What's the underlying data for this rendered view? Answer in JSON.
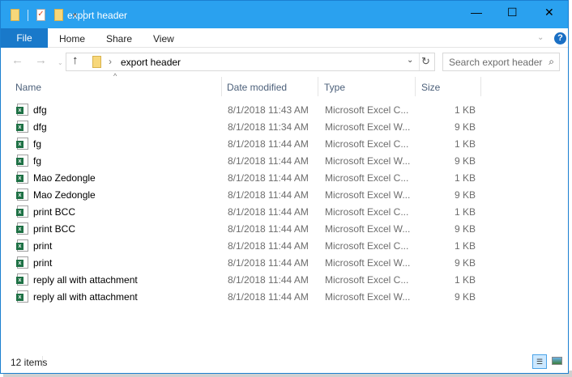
{
  "window": {
    "title": "export header",
    "minimize_icon": "—",
    "maximize_icon": "☐",
    "close_icon": "✕"
  },
  "ribbon": {
    "tabs": [
      "File",
      "Home",
      "Share",
      "View"
    ],
    "help": "?"
  },
  "address": {
    "path": "export header",
    "search_placeholder": "Search export header"
  },
  "columns": [
    "Name",
    "Date modified",
    "Type",
    "Size"
  ],
  "files": [
    {
      "name": "dfg",
      "date": "8/1/2018 11:43 AM",
      "type": "Microsoft Excel C...",
      "size": "1 KB",
      "kind": "csv"
    },
    {
      "name": "dfg",
      "date": "8/1/2018 11:34 AM",
      "type": "Microsoft Excel W...",
      "size": "9 KB",
      "kind": "xlsx"
    },
    {
      "name": "fg",
      "date": "8/1/2018 11:44 AM",
      "type": "Microsoft Excel C...",
      "size": "1 KB",
      "kind": "csv"
    },
    {
      "name": "fg",
      "date": "8/1/2018 11:44 AM",
      "type": "Microsoft Excel W...",
      "size": "9 KB",
      "kind": "xlsx"
    },
    {
      "name": "Mao Zedongle",
      "date": "8/1/2018 11:44 AM",
      "type": "Microsoft Excel C...",
      "size": "1 KB",
      "kind": "csv"
    },
    {
      "name": "Mao Zedongle",
      "date": "8/1/2018 11:44 AM",
      "type": "Microsoft Excel W...",
      "size": "9 KB",
      "kind": "xlsx"
    },
    {
      "name": "print BCC",
      "date": "8/1/2018 11:44 AM",
      "type": "Microsoft Excel C...",
      "size": "1 KB",
      "kind": "csv"
    },
    {
      "name": "print BCC",
      "date": "8/1/2018 11:44 AM",
      "type": "Microsoft Excel W...",
      "size": "9 KB",
      "kind": "xlsx"
    },
    {
      "name": "print",
      "date": "8/1/2018 11:44 AM",
      "type": "Microsoft Excel C...",
      "size": "1 KB",
      "kind": "csv"
    },
    {
      "name": "print",
      "date": "8/1/2018 11:44 AM",
      "type": "Microsoft Excel W...",
      "size": "9 KB",
      "kind": "xlsx"
    },
    {
      "name": "reply all with attachment",
      "date": "8/1/2018 11:44 AM",
      "type": "Microsoft Excel C...",
      "size": "1 KB",
      "kind": "csv"
    },
    {
      "name": "reply all with attachment",
      "date": "8/1/2018 11:44 AM",
      "type": "Microsoft Excel W...",
      "size": "9 KB",
      "kind": "xlsx"
    }
  ],
  "status": {
    "count": "12 items"
  },
  "colors": {
    "titlebar": "#2aa1ef",
    "file_tab": "#1979ca",
    "excel": "#1e7145"
  }
}
